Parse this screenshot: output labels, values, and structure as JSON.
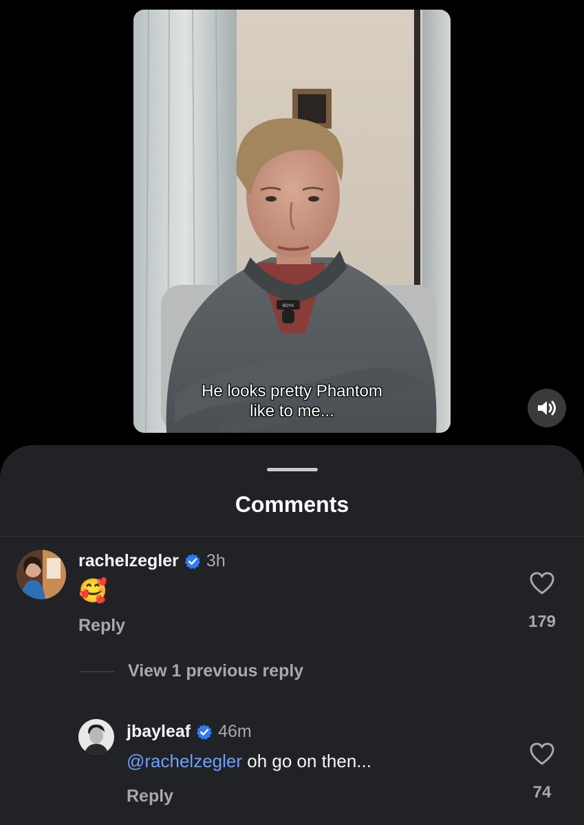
{
  "video": {
    "caption_line1": "He looks pretty Phantom",
    "caption_line2": "like to me...",
    "mic_brand": "BOYA"
  },
  "sheet": {
    "title": "Comments"
  },
  "comments": [
    {
      "username": "rachelzegler",
      "time": "3h",
      "text": "🥰",
      "reply_label": "Reply",
      "likes": "179"
    }
  ],
  "view_previous": "View 1 previous reply",
  "reply": {
    "username": "jbayleaf",
    "time": "46m",
    "mention": "@rachelzegler",
    "text": " oh go on then...",
    "reply_label": "Reply",
    "likes": "74"
  },
  "colors": {
    "sheet_bg": "#212226",
    "mention": "#6f9eff",
    "verified": "#2f7bf5"
  },
  "icons": [
    "volume-on-icon",
    "heart-icon",
    "verified-badge-icon"
  ]
}
